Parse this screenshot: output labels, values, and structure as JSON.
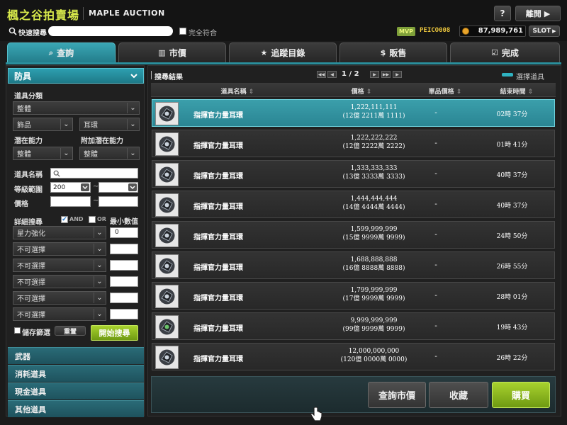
{
  "header": {
    "title": "楓之谷拍賣場",
    "subtitle": "MAPLE AUCTION",
    "help_label": "?",
    "close_label": "離開",
    "quick_search_label": "快速搜尋",
    "exact_match_label": "完全符合",
    "mvp_label": "MVP",
    "username": "PEICO008",
    "meso": "87,989,761",
    "slot_label": "SLOT"
  },
  "tabs": [
    {
      "label": "查詢",
      "icon": "search-icon",
      "active": true
    },
    {
      "label": "市價",
      "icon": "bar-chart-icon",
      "active": false
    },
    {
      "label": "追蹤目錄",
      "icon": "star-icon",
      "active": false
    },
    {
      "label": "販售",
      "icon": "coin-icon",
      "active": false
    },
    {
      "label": "完成",
      "icon": "checkbox-icon",
      "active": false
    }
  ],
  "filters": {
    "category_header": "防具",
    "item_class_label": "道具分類",
    "item_class_value": "整體",
    "sub_class_value": "飾品",
    "type_value": "耳環",
    "potential_label": "潛在能力",
    "bonus_potential_label": "附加潛在能力",
    "potential_value": "整體",
    "bonus_potential_value": "整體",
    "item_name_label": "道具名稱",
    "level_range_label": "等級範圍",
    "level_min": "200",
    "level_max": "",
    "range_sep": "~",
    "price_label": "價格",
    "detail_search_label": "詳細搜尋",
    "and_label": "AND",
    "or_label": "OR",
    "min_value_label": "最小數值",
    "detail_rows": [
      {
        "option": "星力強化",
        "value": "0"
      },
      {
        "option": "不可選擇",
        "value": ""
      },
      {
        "option": "不可選擇",
        "value": ""
      },
      {
        "option": "不可選擇",
        "value": ""
      },
      {
        "option": "不可選擇",
        "value": ""
      },
      {
        "option": "不可選擇",
        "value": ""
      }
    ],
    "save_filter_label": "儲存篩選",
    "reset_label": "重置",
    "start_search_label": "開始搜尋"
  },
  "categories": [
    "武器",
    "消耗道具",
    "現金道具",
    "其他道具"
  ],
  "results": {
    "title": "搜尋結果",
    "page": "1 / 2",
    "select_item_label": "選擇道具",
    "columns": [
      "道具名稱",
      "價格",
      "單品價格",
      "結束時間"
    ],
    "rows": [
      {
        "name": "指揮官力量耳環",
        "price": "1,222,111,111",
        "price_detail": "(12億 2211萬 1111)",
        "unit_price": "-",
        "time": "02時 37分",
        "selected": true
      },
      {
        "name": "指揮官力量耳環",
        "price": "1,222,222,222",
        "price_detail": "(12億 2222萬 2222)",
        "unit_price": "-",
        "time": "01時 41分",
        "selected": false
      },
      {
        "name": "指揮官力量耳環",
        "price": "1,333,333,333",
        "price_detail": "(13億 3333萬 3333)",
        "unit_price": "-",
        "time": "40時 37分",
        "selected": false
      },
      {
        "name": "指揮官力量耳環",
        "price": "1,444,444,444",
        "price_detail": "(14億 4444萬 4444)",
        "unit_price": "-",
        "time": "40時 37分",
        "selected": false
      },
      {
        "name": "指揮官力量耳環",
        "price": "1,599,999,999",
        "price_detail": "(15億 9999萬 9999)",
        "unit_price": "-",
        "time": "24時 50分",
        "selected": false
      },
      {
        "name": "指揮官力量耳環",
        "price": "1,688,888,888",
        "price_detail": "(16億 8888萬 8888)",
        "unit_price": "-",
        "time": "26時 55分",
        "selected": false
      },
      {
        "name": "指揮官力量耳環",
        "price": "1,799,999,999",
        "price_detail": "(17億 9999萬 9999)",
        "unit_price": "-",
        "time": "28時 01分",
        "selected": false
      },
      {
        "name": "指揮官力量耳環",
        "price": "9,999,999,999",
        "price_detail": "(99億 9999萬 9999)",
        "unit_price": "-",
        "time": "19時 43分",
        "selected": false
      },
      {
        "name": "指揮官力量耳環",
        "price": "12,000,000,000",
        "price_detail": "(120億 0000萬 0000)",
        "unit_price": "-",
        "time": "26時 22分",
        "selected": false
      }
    ]
  },
  "actions": {
    "price_check_label": "查詢市價",
    "favorite_label": "收藏",
    "buy_label": "購買"
  },
  "colors": {
    "accent": "#2a8f9c",
    "title": "#d7e84b",
    "buy": "#8cbc1e"
  }
}
